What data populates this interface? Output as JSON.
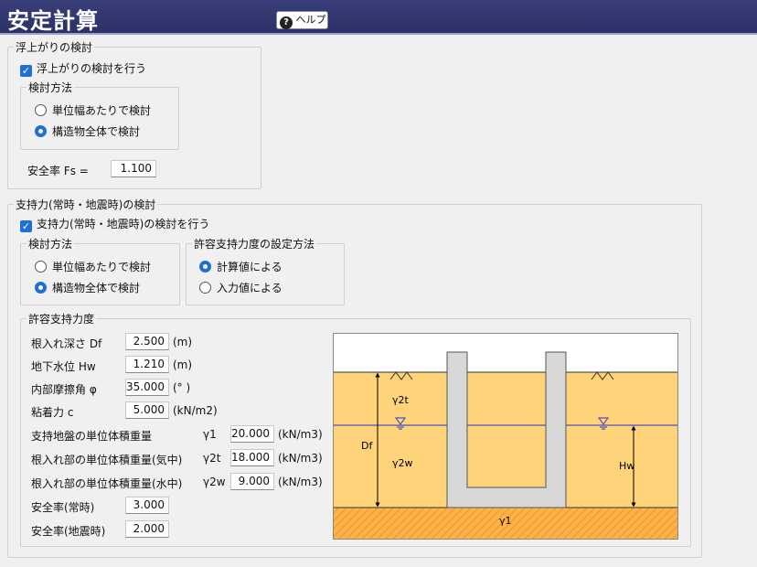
{
  "window": {
    "title": "安定計算",
    "help_label": "ヘルプ",
    "help_icon": "question-circle-icon"
  },
  "uplift": {
    "group_title": "浮上がりの検討",
    "checkbox_label": "浮上がりの検討を行う",
    "checked": true,
    "method": {
      "group_title": "検討方法",
      "options": [
        "単位幅あたりで検討",
        "構造物全体で検討"
      ],
      "selected": 1
    },
    "safety": {
      "label": "安全率 Fs =",
      "value": "1.100"
    }
  },
  "bearing": {
    "group_title": "支持力(常時・地震時)の検討",
    "checkbox_label": "支持力(常時・地震時)の検討を行う",
    "checked": true,
    "method": {
      "group_title": "検討方法",
      "options": [
        "単位幅あたりで検討",
        "構造物全体で検討"
      ],
      "selected": 1
    },
    "setting": {
      "group_title": "許容支持力度の設定方法",
      "options": [
        "計算値による",
        "入力値による"
      ],
      "selected": 0
    },
    "allowable": {
      "group_title": "許容支持力度",
      "params": [
        {
          "label": "根入れ深さ Df",
          "symbol": "",
          "value": "2.500",
          "unit": "(m)"
        },
        {
          "label": "地下水位 Hw",
          "symbol": "",
          "value": "1.210",
          "unit": "(m)"
        },
        {
          "label": "内部摩擦角 φ",
          "symbol": "",
          "value": "35.000",
          "unit": "(° )"
        },
        {
          "label": "粘着力 c",
          "symbol": "",
          "value": "5.000",
          "unit": "(kN/m2)"
        },
        {
          "label": "支持地盤の単位体積重量",
          "symbol": "γ1",
          "value": "20.000",
          "unit": "(kN/m3)"
        },
        {
          "label": "根入れ部の単位体積重量(気中)",
          "symbol": "γ2t",
          "value": "18.000",
          "unit": "(kN/m3)"
        },
        {
          "label": "根入れ部の単位体積重量(水中)",
          "symbol": "γ2w",
          "value": "9.000",
          "unit": "(kN/m3)"
        },
        {
          "label": "安全率(常時)",
          "symbol": "",
          "value": "3.000",
          "unit": ""
        },
        {
          "label": "安全率(地震時)",
          "symbol": "",
          "value": "2.000",
          "unit": ""
        }
      ]
    },
    "diagram": {
      "labels": {
        "g2t": "γ2t",
        "g2w": "γ2w",
        "df": "Df",
        "hw": "Hw",
        "g1": "γ1"
      },
      "colors": {
        "soil": "#ffd37a",
        "base_soil": "#ffb347",
        "hatch": "#e8952e",
        "structure": "#d8d8d8",
        "water": "#5050c0"
      }
    }
  }
}
